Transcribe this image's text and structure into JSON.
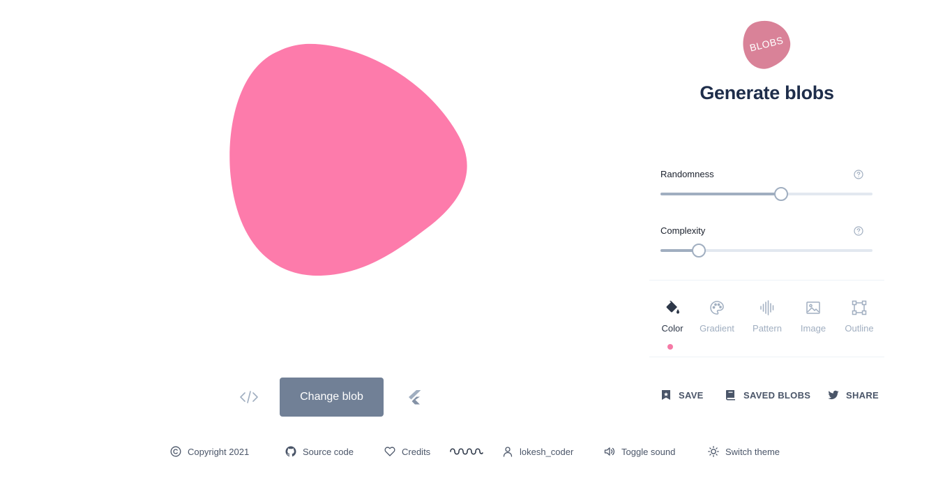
{
  "app": {
    "title": "Generate blobs",
    "logo_text": "BLOBS"
  },
  "colors": {
    "blob_fill": "#fd7bab",
    "logo_fill": "#d98298",
    "button_bg": "#718096",
    "accent_dot": "#f57aa6",
    "title_color": "#1e2d4a"
  },
  "canvas": {
    "change_button_label": "Change blob",
    "code_icon": "code-icon",
    "flutter_icon": "flutter-icon"
  },
  "sliders": [
    {
      "label": "Randomness",
      "value_percent": 57,
      "help_icon": "question-circle-icon"
    },
    {
      "label": "Complexity",
      "value_percent": 18,
      "help_icon": "question-circle-icon"
    }
  ],
  "tabs": [
    {
      "label": "Color",
      "icon": "paint-bucket-icon",
      "active": true
    },
    {
      "label": "Gradient",
      "icon": "palette-icon",
      "active": false
    },
    {
      "label": "Pattern",
      "icon": "waveform-icon",
      "active": false
    },
    {
      "label": "Image",
      "icon": "image-icon",
      "active": false
    },
    {
      "label": "Outline",
      "icon": "outline-square-icon",
      "active": false
    }
  ],
  "actions": [
    {
      "label": "SAVE",
      "icon": "bookmark-icon"
    },
    {
      "label": "SAVED BLOBS",
      "icon": "book-icon"
    },
    {
      "label": "SHARE",
      "icon": "twitter-icon"
    }
  ],
  "footer": [
    {
      "label": "Copyright 2021",
      "icon": "copyright-icon"
    },
    {
      "label": "Source code",
      "icon": "github-icon"
    },
    {
      "label": "Credits",
      "icon": "heart-icon"
    },
    {
      "label": "",
      "icon": "squiggle-logo-icon"
    },
    {
      "label": "lokesh_coder",
      "icon": "user-icon"
    },
    {
      "label": "Toggle sound",
      "icon": "speaker-icon"
    },
    {
      "label": "Switch theme",
      "icon": "sun-icon"
    }
  ]
}
